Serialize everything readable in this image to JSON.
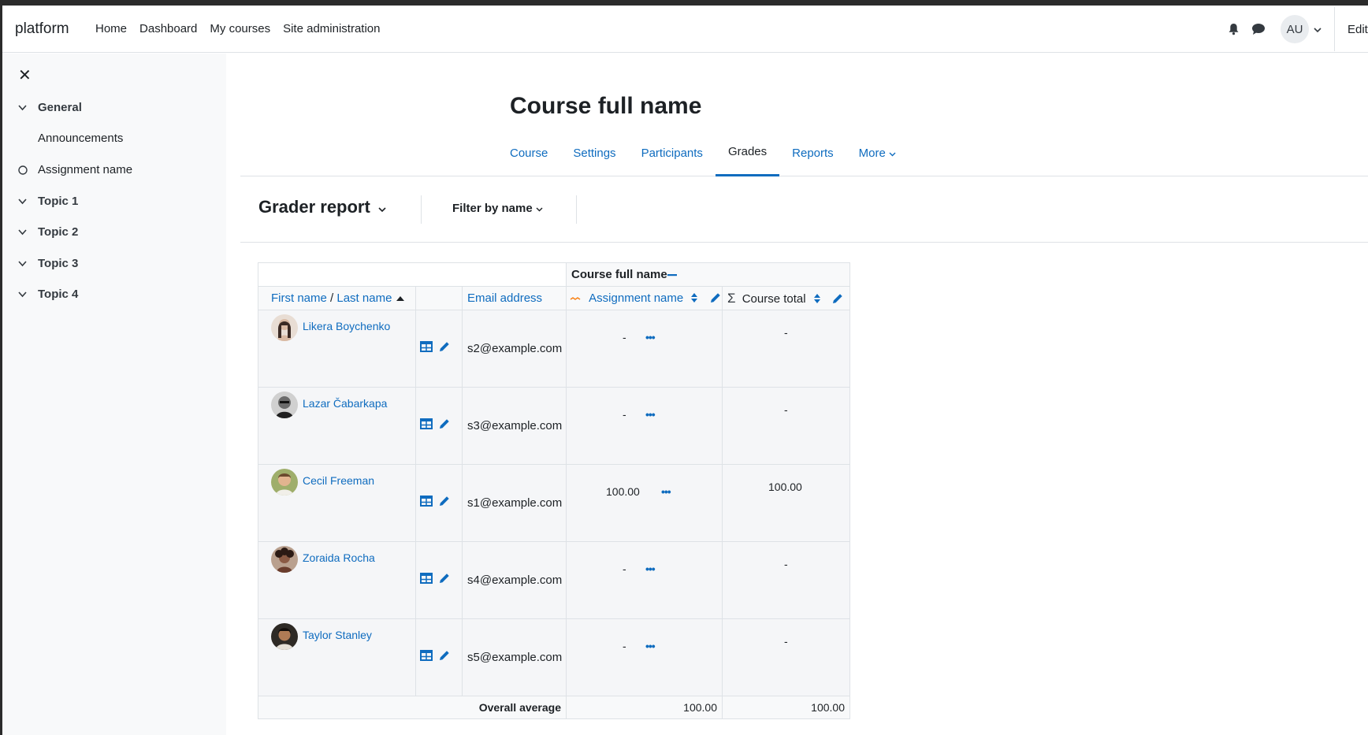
{
  "navbar": {
    "brand": "platform",
    "links": [
      "Home",
      "Dashboard",
      "My courses",
      "Site administration"
    ],
    "user_initials": "AU",
    "edit_label": "Edit"
  },
  "drawer": {
    "close": "✕",
    "items": [
      {
        "label": "General",
        "type": "section"
      },
      {
        "label": "Announcements",
        "type": "activity"
      },
      {
        "label": "Assignment name",
        "type": "activity-circle"
      },
      {
        "label": "Topic 1",
        "type": "section"
      },
      {
        "label": "Topic 2",
        "type": "section"
      },
      {
        "label": "Topic 3",
        "type": "section"
      },
      {
        "label": "Topic 4",
        "type": "section"
      }
    ]
  },
  "page": {
    "title": "Course full name",
    "tabs": [
      "Course",
      "Settings",
      "Participants",
      "Grades",
      "Reports",
      "More"
    ],
    "active_tab": "Grades"
  },
  "tertiary": {
    "report_selector": "Grader report",
    "filter": "Filter by name"
  },
  "grader": {
    "category": "Course full name",
    "col_firstname": "First name",
    "col_sep": " / ",
    "col_lastname": "Last name",
    "col_email": "Email address",
    "col_assignment": "Assignment name",
    "col_total": "Course total",
    "rows": [
      {
        "name": "Likera Boychenko",
        "email": "s2@example.com",
        "grade": "-",
        "total": "-",
        "avatar_color": "#c9b1a4"
      },
      {
        "name": "Lazar Čabarkapa",
        "email": "s3@example.com",
        "grade": "-",
        "total": "-",
        "avatar_color": "#3a3a3a"
      },
      {
        "name": "Cecil Freeman",
        "email": "s1@example.com",
        "grade": "100.00",
        "total": "100.00",
        "avatar_color": "#8a9a5b"
      },
      {
        "name": "Zoraida Rocha",
        "email": "s4@example.com",
        "grade": "-",
        "total": "-",
        "avatar_color": "#7a4b3a"
      },
      {
        "name": "Taylor Stanley",
        "email": "s5@example.com",
        "grade": "-",
        "total": "-",
        "avatar_color": "#4a3526"
      }
    ],
    "overall_label": "Overall average",
    "overall_assignment": "100.00",
    "overall_total": "100.00"
  },
  "colors": {
    "link": "#0f6cbf",
    "drawer_bg": "#f8f9fa"
  }
}
